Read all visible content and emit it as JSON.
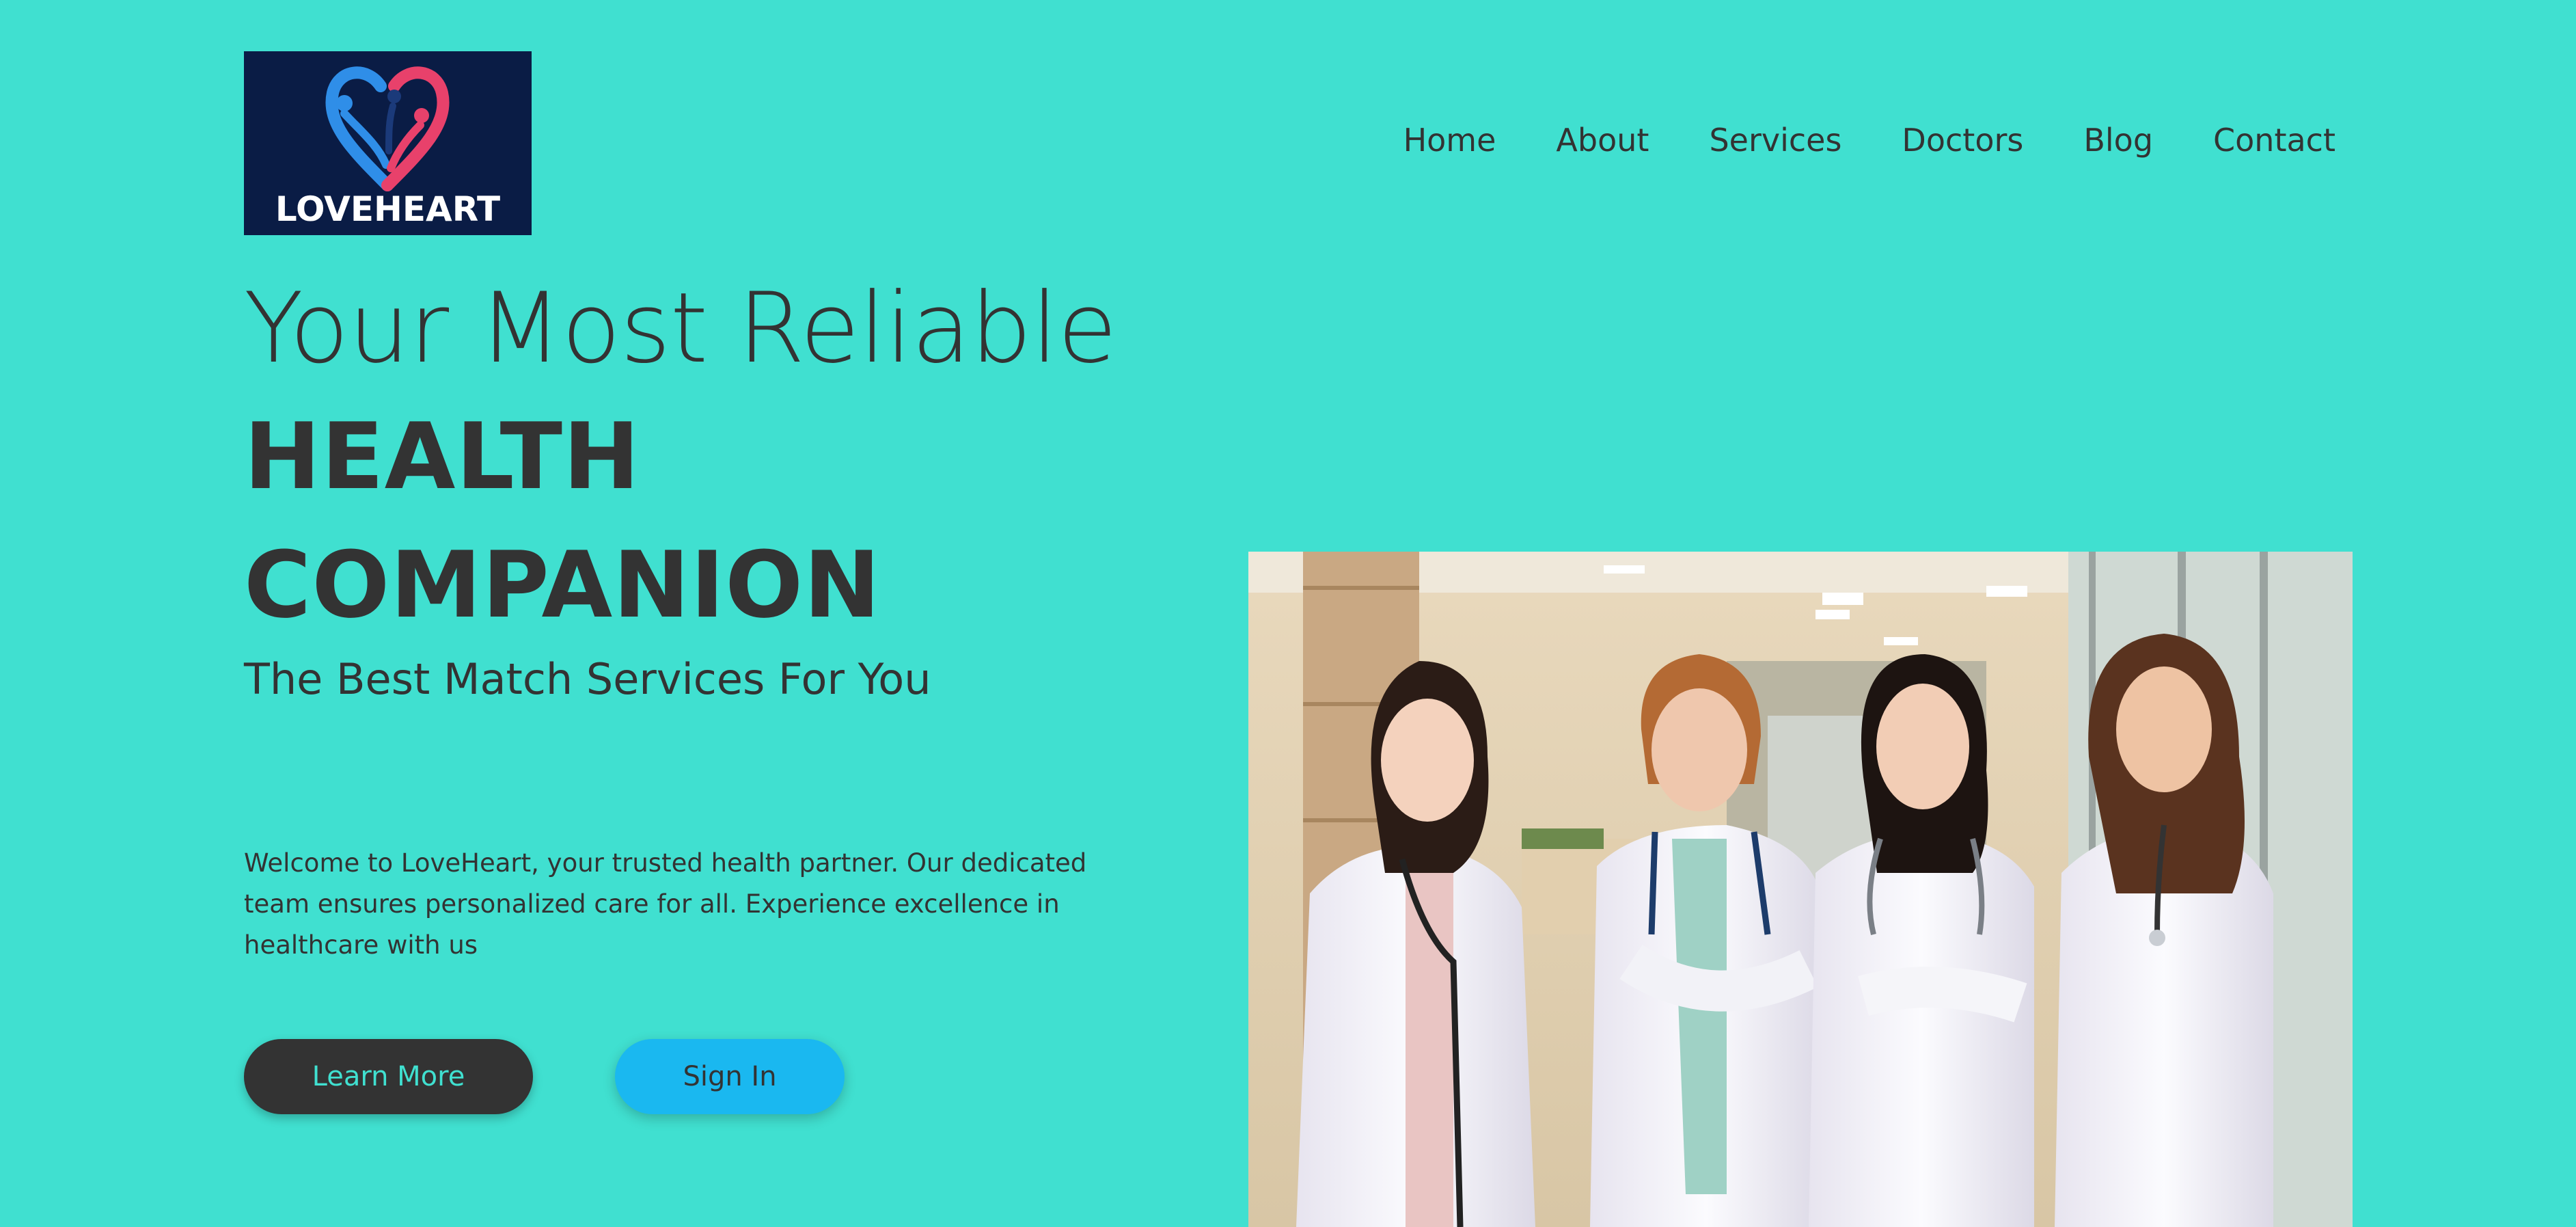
{
  "logo": {
    "text": "LOVEHEART",
    "icon": "heart-people-icon",
    "background": "#0a1c45",
    "heart_colors": [
      "#2f8ee8",
      "#e8416b"
    ]
  },
  "nav": {
    "items": [
      {
        "label": "Home"
      },
      {
        "label": "About"
      },
      {
        "label": "Services"
      },
      {
        "label": "Doctors"
      },
      {
        "label": "Blog"
      },
      {
        "label": "Contact"
      }
    ]
  },
  "hero": {
    "headline_light": "Your Most Reliable",
    "headline_bold_1": "HEALTH",
    "headline_bold_2": "COMPANION",
    "subheadline": "The Best Match Services For You",
    "description": "Welcome to LoveHeart, your trusted health partner. Our dedicated team ensures personalized care for all. Experience excellence in healthcare with us",
    "primary_button": "Learn More",
    "secondary_button": "Sign In"
  },
  "photo": {
    "subject": "four-doctors-in-hospital-corridor"
  },
  "colors": {
    "background": "#40e0d0",
    "text": "#333333",
    "primary_button_bg": "#333333",
    "primary_button_text": "#40e0d0",
    "secondary_button_bg": "#1ab8f0"
  }
}
